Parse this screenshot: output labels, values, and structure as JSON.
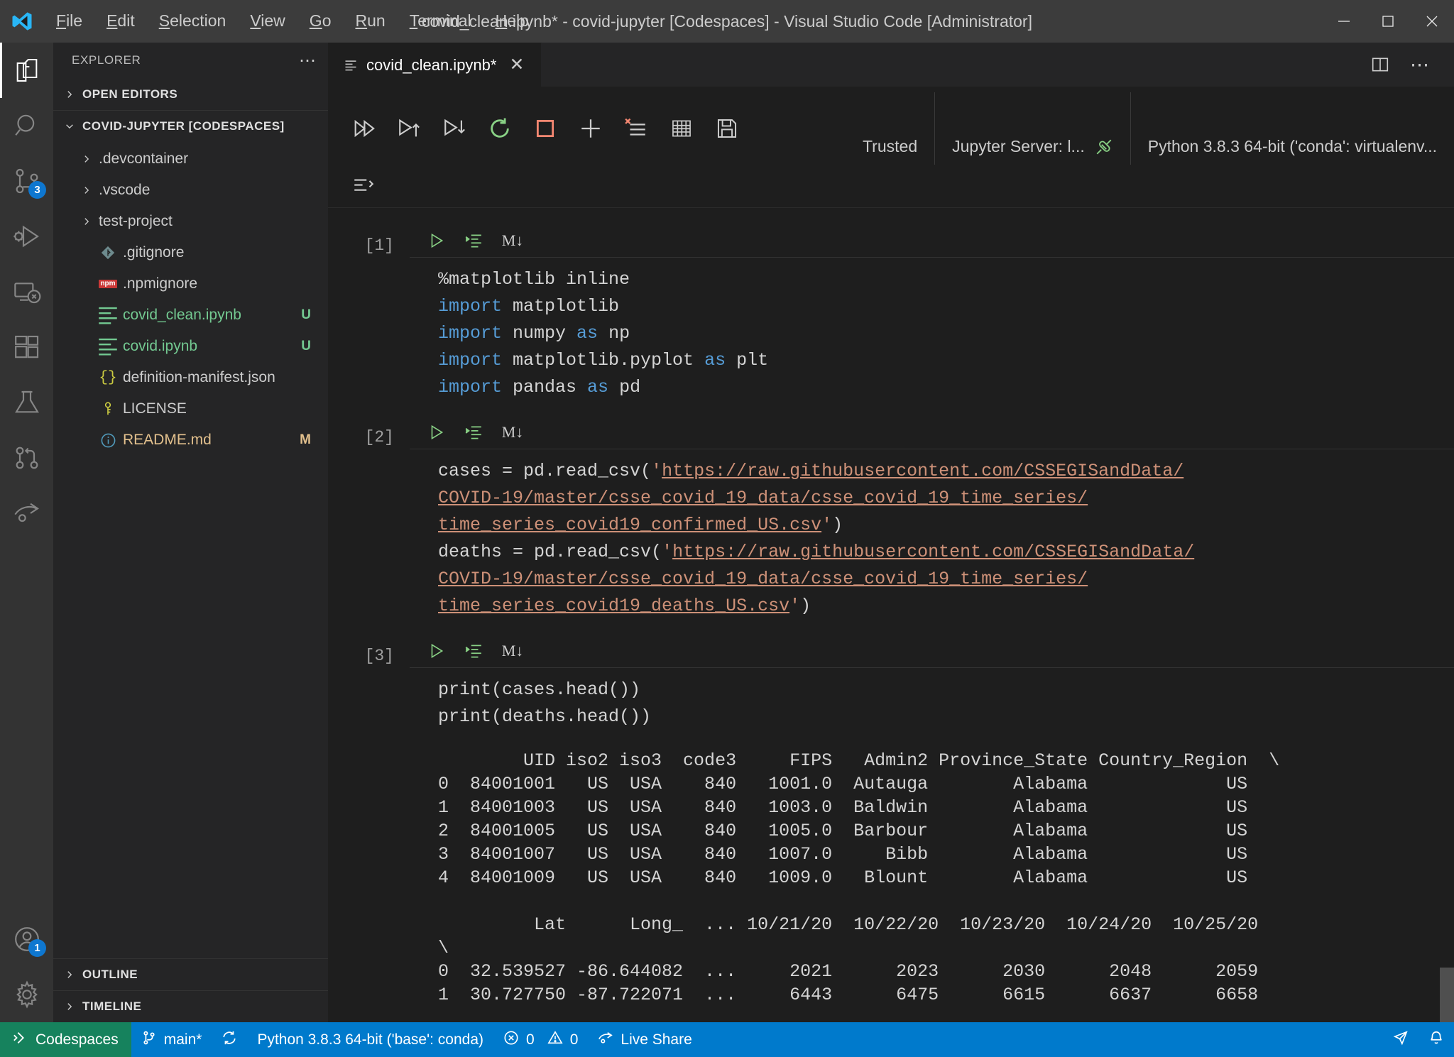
{
  "titlebar": {
    "title": "covid_clean.ipynb* - covid-jupyter [Codespaces] - Visual Studio Code [Administrator]",
    "menu": [
      {
        "label": "File",
        "accel": "F"
      },
      {
        "label": "Edit",
        "accel": "E"
      },
      {
        "label": "Selection",
        "accel": "S"
      },
      {
        "label": "View",
        "accel": "V"
      },
      {
        "label": "Go",
        "accel": "G"
      },
      {
        "label": "Run",
        "accel": "R"
      },
      {
        "label": "Terminal",
        "accel": "T"
      },
      {
        "label": "Help",
        "accel": "H"
      }
    ],
    "controls": {
      "minimize": "minimize-button",
      "maximize": "maximize-button",
      "close": "close-button"
    }
  },
  "activitybar": {
    "items": [
      {
        "name": "explorer",
        "icon": "files-icon",
        "badge": null,
        "active": true
      },
      {
        "name": "search",
        "icon": "search-icon",
        "badge": null,
        "active": false
      },
      {
        "name": "source-control",
        "icon": "source-control-icon",
        "badge": "3",
        "active": false
      },
      {
        "name": "run-and-debug",
        "icon": "debug-icon",
        "badge": null,
        "active": false
      },
      {
        "name": "remote-explorer",
        "icon": "remote-icon",
        "badge": null,
        "active": false
      },
      {
        "name": "extensions",
        "icon": "extensions-icon",
        "badge": null,
        "active": false
      },
      {
        "name": "testing",
        "icon": "beaker-icon",
        "badge": null,
        "active": false
      },
      {
        "name": "github-pull-requests",
        "icon": "git-pull-request-icon",
        "badge": null,
        "active": false
      },
      {
        "name": "live-share",
        "icon": "live-share-icon",
        "badge": null,
        "active": false
      }
    ],
    "bottom": [
      {
        "name": "accounts",
        "icon": "account-icon",
        "badge": "1"
      },
      {
        "name": "manage",
        "icon": "gear-icon",
        "badge": null
      }
    ]
  },
  "sidebar": {
    "title": "EXPLORER",
    "more_actions": "⋯",
    "sections": [
      {
        "label": "OPEN EDITORS",
        "expanded": false
      },
      {
        "label": "COVID-JUPYTER [CODESPACES]",
        "expanded": true
      }
    ],
    "tree": [
      {
        "label": ".devcontainer",
        "type": "folder",
        "icon": "chevron-right-icon",
        "badge": "",
        "color": "normal"
      },
      {
        "label": ".vscode",
        "type": "folder",
        "icon": "chevron-right-icon",
        "badge": "",
        "color": "normal"
      },
      {
        "label": "test-project",
        "type": "folder",
        "icon": "chevron-right-icon",
        "badge": "",
        "color": "normal"
      },
      {
        "label": ".gitignore",
        "type": "file",
        "icon": "git-icon",
        "badge": "",
        "color": "normal"
      },
      {
        "label": ".npmignore",
        "type": "file",
        "icon": "npm-icon",
        "badge": "",
        "color": "normal"
      },
      {
        "label": "covid_clean.ipynb",
        "type": "file",
        "icon": "notebook-icon",
        "badge": "U",
        "color": "green"
      },
      {
        "label": "covid.ipynb",
        "type": "file",
        "icon": "notebook-icon",
        "badge": "U",
        "color": "green"
      },
      {
        "label": "definition-manifest.json",
        "type": "file",
        "icon": "json-icon",
        "badge": "",
        "color": "normal"
      },
      {
        "label": "LICENSE",
        "type": "file",
        "icon": "key-icon",
        "badge": "",
        "color": "normal"
      },
      {
        "label": "README.md",
        "type": "file",
        "icon": "info-icon",
        "badge": "M",
        "color": "orange"
      }
    ],
    "footer": [
      {
        "label": "OUTLINE"
      },
      {
        "label": "TIMELINE"
      }
    ]
  },
  "editor": {
    "tab": {
      "title": "covid_clean.ipynb*",
      "close": "✕",
      "icon": "notebook-icon"
    },
    "tab_actions": [
      {
        "name": "split-editor-button",
        "icon": "split-editor-icon"
      },
      {
        "name": "more-actions-button",
        "icon": "ellipsis-icon",
        "label": "⋯"
      }
    ],
    "notebook_toolbar": {
      "buttons": [
        {
          "name": "run-all-button",
          "icon": "run-all-icon",
          "title": "Run All"
        },
        {
          "name": "run-above-button",
          "icon": "run-above-icon",
          "title": "Run Above"
        },
        {
          "name": "run-below-button",
          "icon": "run-below-icon",
          "title": "Run Below"
        },
        {
          "name": "restart-kernel-button",
          "icon": "restart-icon",
          "title": "Restart Kernel"
        },
        {
          "name": "interrupt-kernel-button",
          "icon": "stop-square-icon",
          "title": "Interrupt Kernel"
        },
        {
          "name": "add-cell-button",
          "icon": "plus-icon",
          "title": "Add Cell"
        },
        {
          "name": "clear-outputs-button",
          "icon": "clear-outputs-icon",
          "title": "Clear All Outputs"
        },
        {
          "name": "variables-button",
          "icon": "variables-grid-icon",
          "title": "Variables"
        },
        {
          "name": "export-button",
          "icon": "save-disk-icon",
          "title": "Export"
        }
      ],
      "second_row": [
        {
          "name": "collapse-cells-button",
          "icon": "collapse-cells-icon"
        }
      ],
      "status": {
        "trusted": "Trusted",
        "server": "Jupyter Server: l...",
        "server_icon": "plug-icon",
        "kernel": "Python 3.8.3 64-bit ('conda': virtualenv..."
      }
    },
    "cells": [
      {
        "exec_count": "[1]",
        "toolbar": {
          "run": "run-cell-icon",
          "output": "run-output-icon",
          "markdown": "M↓"
        },
        "code_html": "<span class=\"magic\">%matplotlib</span> inline\n<span class=\"kw\">import</span> matplotlib\n<span class=\"kw\">import</span> numpy <span class=\"kw\">as</span> np\n<span class=\"kw\">import</span> matplotlib.pyplot <span class=\"kw\">as</span> plt\n<span class=\"kw\">import</span> pandas <span class=\"kw\">as</span> pd",
        "code_text": "%matplotlib inline\nimport matplotlib\nimport numpy as np\nimport matplotlib.pyplot as plt\nimport pandas as pd",
        "output_text": ""
      },
      {
        "exec_count": "[2]",
        "toolbar": {
          "run": "run-cell-icon",
          "output": "run-output-icon",
          "markdown": "M↓"
        },
        "code_html": "cases = pd.read_csv(<span class=\"str\">'</span><span class=\"link\">https://raw.githubusercontent.com/CSSEGISandData/\nCOVID-19/master/csse_covid_19_data/csse_covid_19_time_series/\ntime_series_covid19_confirmed_US.csv</span><span class=\"str\">'</span>)\ndeaths = pd.read_csv(<span class=\"str\">'</span><span class=\"link\">https://raw.githubusercontent.com/CSSEGISandData/\nCOVID-19/master/csse_covid_19_data/csse_covid_19_time_series/\ntime_series_covid19_deaths_US.csv</span><span class=\"str\">'</span>)",
        "code_text": "cases = pd.read_csv('https://raw.githubusercontent.com/CSSEGISandData/COVID-19/master/csse_covid_19_data/csse_covid_19_time_series/time_series_covid19_confirmed_US.csv')\ndeaths = pd.read_csv('https://raw.githubusercontent.com/CSSEGISandData/COVID-19/master/csse_covid_19_data/csse_covid_19_time_series/time_series_covid19_deaths_US.csv')",
        "output_text": ""
      },
      {
        "exec_count": "[3]",
        "toolbar": {
          "run": "run-cell-icon",
          "output": "run-output-icon",
          "markdown": "M↓"
        },
        "code_html": "print(cases.head())\nprint(deaths.head())",
        "code_text": "print(cases.head())\nprint(deaths.head())",
        "output_text": "        UID iso2 iso3  code3     FIPS   Admin2 Province_State Country_Region  \\\n0  84001001   US  USA    840   1001.0  Autauga        Alabama             US\n1  84001003   US  USA    840   1003.0  Baldwin        Alabama             US\n2  84001005   US  USA    840   1005.0  Barbour        Alabama             US\n3  84001007   US  USA    840   1007.0     Bibb        Alabama             US\n4  84001009   US  USA    840   1009.0   Blount        Alabama             US\n\n         Lat      Long_  ... 10/21/20  10/22/20  10/23/20  10/24/20  10/25/20\n\\\n0  32.539527 -86.644082  ...     2021      2023      2030      2048      2059\n1  30.727750 -87.722071  ...     6443      6475      6615      6637      6658"
      }
    ]
  },
  "statusbar": {
    "remote": {
      "label": "Codespaces",
      "icon": "remote-indicator-icon"
    },
    "items": [
      {
        "name": "branch",
        "label": "main*",
        "icon": "git-branch-icon"
      },
      {
        "name": "sync",
        "label": "",
        "icon": "sync-icon"
      },
      {
        "name": "python-interpreter",
        "label": "Python 3.8.3 64-bit ('base': conda)",
        "icon": ""
      },
      {
        "name": "problems",
        "label": "0",
        "icon": "error-icon",
        "label2": "0",
        "icon2": "warning-icon"
      },
      {
        "name": "live-share",
        "label": "Live Share",
        "icon": "live-share-icon"
      }
    ],
    "right": [
      {
        "name": "feedback",
        "icon": "feedback-icon"
      },
      {
        "name": "notifications",
        "icon": "bell-icon"
      }
    ]
  }
}
